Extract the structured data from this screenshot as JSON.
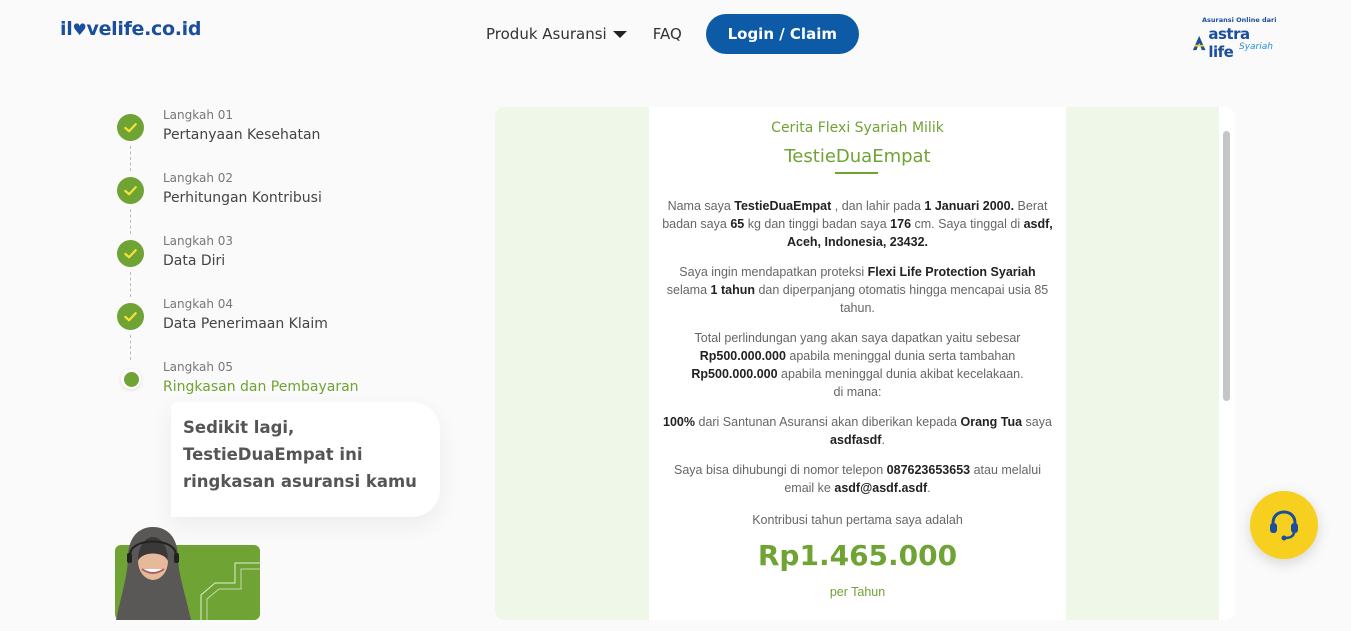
{
  "header": {
    "logo_text_pre": "il",
    "logo_text_post": "velife.co.id",
    "nav": {
      "products_label": "Produk Asuransi",
      "faq_label": "FAQ",
      "login_label": "Login / Claim"
    },
    "brand": {
      "top": "Asuransi Online dari",
      "name": "astra life",
      "sub": "Syariah"
    }
  },
  "steps": [
    {
      "small": "Langkah 01",
      "title": "Pertanyaan Kesehatan",
      "status": "done"
    },
    {
      "small": "Langkah 02",
      "title": "Perhitungan Kontribusi",
      "status": "done"
    },
    {
      "small": "Langkah 03",
      "title": "Data Diri",
      "status": "done"
    },
    {
      "small": "Langkah 04",
      "title": "Data Penerimaan Klaim",
      "status": "done"
    },
    {
      "small": "Langkah 05",
      "title": "Ringkasan dan Pembayaran",
      "status": "active"
    }
  ],
  "bubble": {
    "line1": "Sedikit lagi,",
    "line2": "TestieDuaEmpat ini",
    "line3": "ringkasan asuransi kamu"
  },
  "summary": {
    "label": "Cerita Flexi Syariah Milik",
    "name": "TestieDuaEmpat",
    "p1": {
      "t1": "Nama saya ",
      "name": "TestieDuaEmpat",
      "t2": " , dan lahir pada ",
      "dob": "1 Januari 2000.",
      "t3": " Berat badan saya ",
      "weight": "65",
      "t4": " kg dan tinggi badan saya ",
      "height": "176",
      "t5": " cm. Saya tinggal di ",
      "address": "asdf, Aceh, Indonesia, 23432."
    },
    "p2": {
      "t1": "Saya ingin mendapatkan proteksi ",
      "product": "Flexi Life Protection Syariah",
      "t2": " selama ",
      "period": "1 tahun",
      "t3": " dan diperpanjang otomatis hingga mencapai usia 85 tahun."
    },
    "p3": {
      "t1": "Total perlindungan yang akan saya dapatkan yaitu sebesar ",
      "amount1": "Rp500.000.000",
      "t2": " apabila meninggal dunia serta tambahan ",
      "amount2": "Rp500.000.000",
      "t3": " apabila meninggal dunia akibat kecelakaan.",
      "t4": "di mana:"
    },
    "p4": {
      "pct": "100%",
      "t1": " dari Santunan Asuransi akan diberikan kepada ",
      "relation": "Orang Tua",
      "t2": " saya ",
      "beneficiary": "asdfasdf",
      "t3": "."
    },
    "p5": {
      "t1": "Saya bisa dihubungi di nomor telepon ",
      "phone": "087623653653",
      "t2": " atau melalui email ke ",
      "email": "asdf@asdf.asdf",
      "t3": "."
    },
    "contribution_label": "Kontribusi tahun pertama saya adalah",
    "price": "Rp1.465.000",
    "per": "per Tahun"
  },
  "icons": {
    "check": "check-icon",
    "caret": "caret-down-icon",
    "help": "headset-icon"
  },
  "colors": {
    "primary_blue": "#0d5aa7",
    "green": "#6fa334",
    "yellow": "#f7cf1f"
  }
}
